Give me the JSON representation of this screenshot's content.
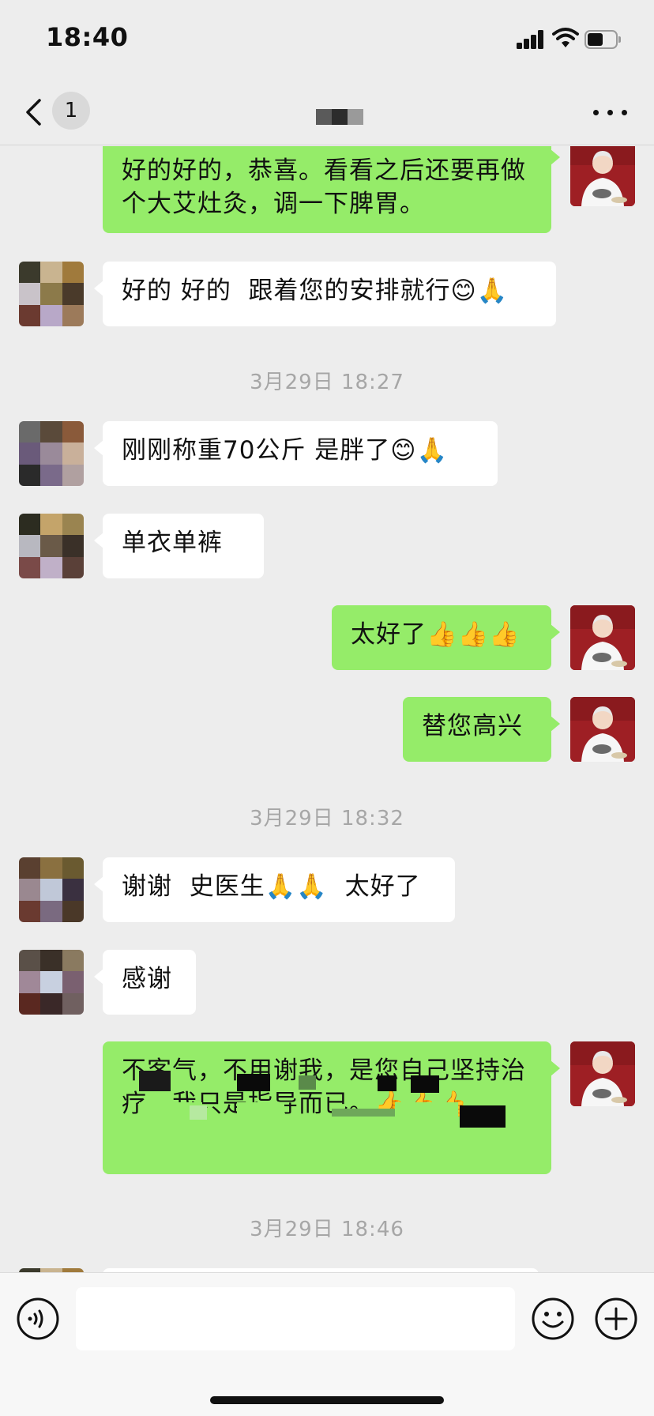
{
  "status_bar": {
    "time": "18:40",
    "battery_level": 0.55
  },
  "nav": {
    "unread_count": "1",
    "title": ""
  },
  "messages": {
    "m1": "好的好的，恭喜。看看之后还要再做个大艾灶灸，调一下脾胃。",
    "m2": "好的 好的  跟着您的安排就行😊🙏",
    "t1": "3月29日 18:27",
    "m3": "刚刚称重70公斤 是胖了😊🙏",
    "m4": "单衣单裤",
    "m5": "太好了👍👍👍",
    "m6": "替您高兴",
    "t2": "3月29日 18:32",
    "m7": "谢谢  史医生🙏🙏  太好了",
    "m8": "感谢",
    "m9": "不客气，不用谢我，是您自己坚持治疗，我只是指导而已。👍👍👍",
    "t3": "3月29日 18:46"
  },
  "input": {
    "placeholder": ""
  },
  "icons": {
    "back": "chevron-left-icon",
    "more": "more-horizontal-icon",
    "voice": "voice-icon",
    "emoji": "emoji-icon",
    "plus": "plus-icon"
  },
  "colors": {
    "bubble_self": "#95ec69",
    "bubble_other": "#ffffff",
    "background": "#ededed",
    "doctor_avatar": "#9e1f24"
  }
}
